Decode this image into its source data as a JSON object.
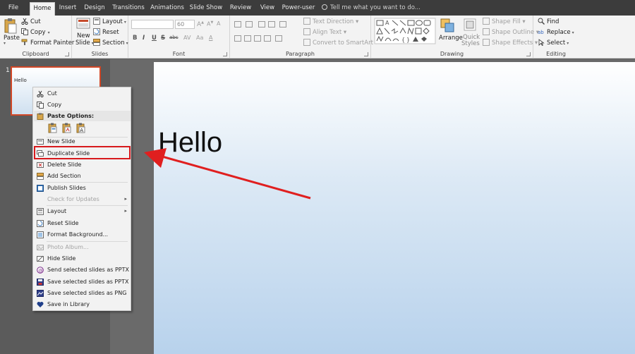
{
  "tabs": [
    "File",
    "Home",
    "Insert",
    "Design",
    "Transitions",
    "Animations",
    "Slide Show",
    "Review",
    "View",
    "Power-user"
  ],
  "active_tab": "Home",
  "tell_me": "Tell me what you want to do...",
  "clipboard": {
    "paste": "Paste",
    "cut": "Cut",
    "copy": "Copy",
    "format_painter": "Format Painter",
    "label": "Clipboard"
  },
  "slides_group": {
    "new_slide_1": "New",
    "new_slide_2": "Slide",
    "layout": "Layout",
    "reset": "Reset",
    "section": "Section",
    "label": "Slides"
  },
  "font_group": {
    "font_size": "60",
    "label": "Font",
    "bold": "B",
    "italic": "I",
    "underline": "U",
    "strike": "S",
    "shadow": "abc"
  },
  "paragraph_group": {
    "text_direction": "Text Direction",
    "align_text": "Align Text",
    "convert_smartart": "Convert to SmartArt",
    "label": "Paragraph"
  },
  "drawing_group": {
    "arrange": "Arrange",
    "quick_styles_1": "Quick",
    "quick_styles_2": "Styles",
    "shape_fill": "Shape Fill",
    "shape_outline": "Shape Outline",
    "shape_effects": "Shape Effects",
    "label": "Drawing"
  },
  "editing_group": {
    "find": "Find",
    "replace": "Replace",
    "select": "Select",
    "label": "Editing"
  },
  "slide_panel": {
    "slide_number": "1",
    "thumb_text": "Hello"
  },
  "slide": {
    "title": "Hello"
  },
  "context_menu": {
    "cut": "Cut",
    "copy": "Copy",
    "paste_options": "Paste Options:",
    "new_slide": "New Slide",
    "duplicate_slide": "Duplicate Slide",
    "delete_slide": "Delete Slide",
    "add_section": "Add Section",
    "publish_slides": "Publish Slides",
    "check_updates": "Check for Updates",
    "layout": "Layout",
    "reset_slide": "Reset Slide",
    "format_background": "Format Background...",
    "photo_album": "Photo Album...",
    "hide_slide": "Hide Slide",
    "send_pptx": "Send selected slides as PPTX",
    "save_pptx": "Save selected slides as PPTX",
    "save_png": "Save selected slides as PNG",
    "save_library": "Save in Library"
  },
  "colors": {
    "accent": "#d24726",
    "highlight": "#d7191c",
    "tabbar": "#3c3c3c",
    "ribbon": "#f3f3f3",
    "pane": "#5b5b5b"
  }
}
